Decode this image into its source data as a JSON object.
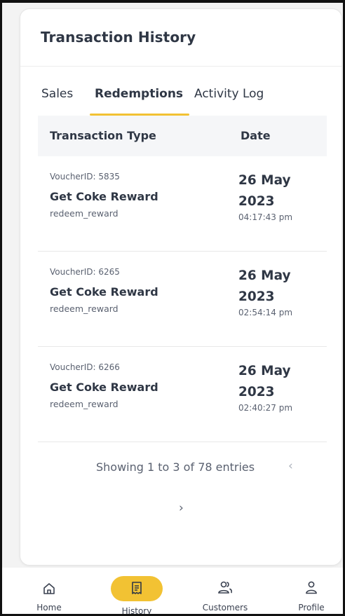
{
  "header": {
    "title": "Transaction History"
  },
  "tabs": [
    {
      "label": "Sales",
      "active": false
    },
    {
      "label": "Redemptions",
      "active": true
    },
    {
      "label": "Activity Log",
      "active": false
    }
  ],
  "table": {
    "columns": [
      "Transaction Type",
      "Date"
    ],
    "rows": [
      {
        "voucher": "VoucherID: 5835",
        "name": "Get Coke Reward",
        "key": "redeem_reward",
        "date": "26 May 2023",
        "time": "04:17:43 pm"
      },
      {
        "voucher": "VoucherID: 6265",
        "name": "Get Coke Reward",
        "key": "redeem_reward",
        "date": "26 May 2023",
        "time": "02:54:14 pm"
      },
      {
        "voucher": "VoucherID: 6266",
        "name": "Get Coke Reward",
        "key": "redeem_reward",
        "date": "26 May 2023",
        "time": "02:40:27 pm"
      }
    ]
  },
  "pagination": {
    "summary": "Showing 1 to 3 of 78 entries",
    "prev": "‹",
    "next": "›"
  },
  "bottom_nav": [
    {
      "label": "Home",
      "icon": "home-icon",
      "active": false
    },
    {
      "label": "History",
      "icon": "receipt-icon",
      "active": true
    },
    {
      "label": "Customers",
      "icon": "customers-icon",
      "active": false
    },
    {
      "label": "Profile",
      "icon": "profile-icon",
      "active": false
    }
  ],
  "colors": {
    "accent": "#f2c233",
    "text": "#2f3745",
    "muted": "#5a6170"
  }
}
